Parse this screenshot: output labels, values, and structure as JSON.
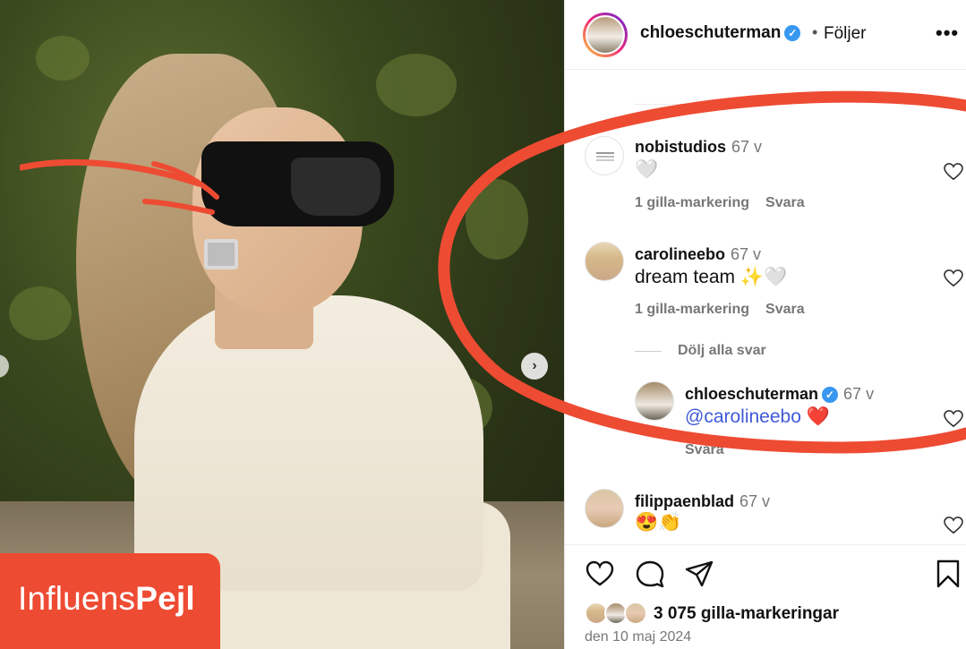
{
  "post": {
    "username": "chloeschuterman",
    "separator": "•",
    "follow_label": "Följer",
    "more_label": "•••"
  },
  "comments": [
    {
      "username": "nobistudios",
      "time": "67 v",
      "text": "🤍",
      "likes": "1 gilla-markering",
      "reply_label": "Svara"
    },
    {
      "username": "carolineebo",
      "time": "67 v",
      "text": "dream team ✨🤍",
      "likes": "1 gilla-markering",
      "reply_label": "Svara",
      "hide_replies": "Dölj alla svar",
      "reply": {
        "username": "chloeschuterman",
        "time": "67 v",
        "mention": "@carolineebo",
        "emoji": "❤️",
        "reply_label": "Svara"
      }
    },
    {
      "username": "filippaenblad",
      "time": "67 v",
      "text": "😍👏"
    }
  ],
  "likes_count": "3 075 gilla-markeringar",
  "date": "den 10 maj 2024",
  "brand": {
    "part1": "Influens",
    "part2": "Pejl",
    "color": "#ee4b33"
  },
  "accent": {
    "verified": "#3897f0",
    "mention": "#3f5ad8",
    "overlay_red": "#ee4b33"
  },
  "photo_nav_icon": "chevron-right-icon"
}
